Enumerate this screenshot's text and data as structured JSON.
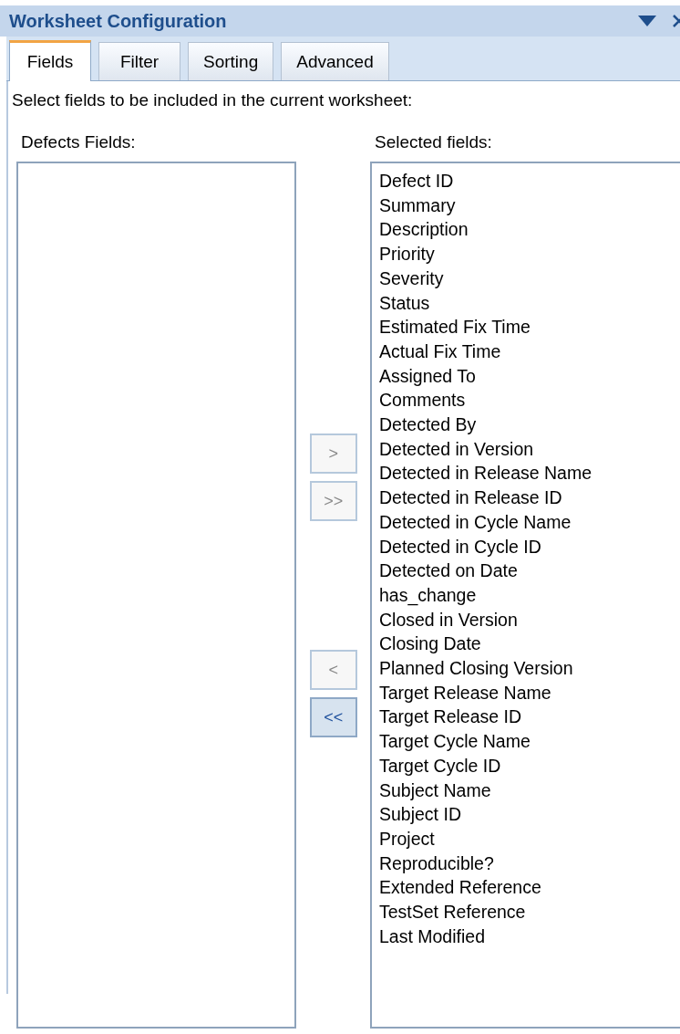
{
  "window": {
    "title": "Worksheet Configuration"
  },
  "tabs": [
    {
      "label": "Fields",
      "selected": true
    },
    {
      "label": "Filter",
      "selected": false
    },
    {
      "label": "Sorting",
      "selected": false
    },
    {
      "label": "Advanced",
      "selected": false
    }
  ],
  "instruction": "Select fields to be included in the current worksheet:",
  "available_list": {
    "label": "Defects Fields:"
  },
  "selected_list": {
    "label": "Selected fields:",
    "items": [
      "Defect ID",
      "Summary",
      "Description",
      "Priority",
      "Severity",
      "Status",
      "Estimated Fix Time",
      "Actual Fix Time",
      "Assigned To",
      "Comments",
      "Detected By",
      "Detected in Version",
      "Detected in Release Name",
      "Detected in Release ID",
      "Detected in Cycle Name",
      "Detected in Cycle ID",
      "Detected on Date",
      "has_change",
      "Closed in Version",
      "Closing Date",
      "Planned Closing Version",
      "Target Release Name",
      "Target Release ID",
      "Target Cycle Name",
      "Target Cycle ID",
      "Subject Name",
      "Subject ID",
      "Project",
      "Reproducible?",
      "Extended Reference",
      "TestSet Reference",
      "Last Modified"
    ]
  },
  "move_buttons": [
    {
      "label": ">",
      "disabled": true
    },
    {
      "label": ">>",
      "disabled": true
    },
    {
      "label": "<",
      "disabled": true
    },
    {
      "label": "<<",
      "disabled": false
    }
  ]
}
